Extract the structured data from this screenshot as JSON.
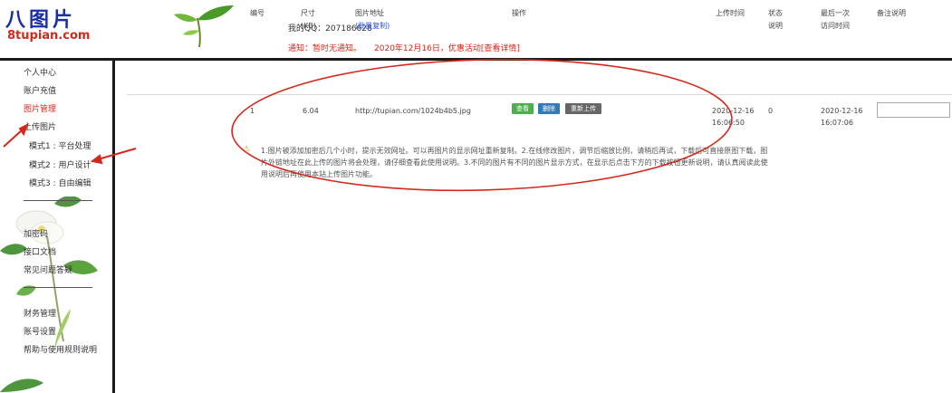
{
  "header": {
    "logo_text": "八图片",
    "logo_url": "8tupian.com",
    "user_info": "我的QQ：207186628",
    "notice_a": "通知：暂时无通知。",
    "notice_b": "2020年12月16日，优惠活动",
    "notice_link": "[查看详情]"
  },
  "sidebar": {
    "items": [
      {
        "label": "个人中心"
      },
      {
        "label": "账户充值"
      },
      {
        "label": "图片管理"
      },
      {
        "label": "上传图片"
      },
      {
        "label": "模式1 : 平台处理"
      },
      {
        "label": "模式2 : 用户设计"
      },
      {
        "label": "模式3 : 自由编辑"
      },
      {
        "label": "加密码"
      },
      {
        "label": "接口文档"
      },
      {
        "label": "常见问题答疑"
      },
      {
        "label": "财务管理"
      },
      {
        "label": "账号设置"
      },
      {
        "label": "帮助与使用规则说明"
      }
    ]
  },
  "table": {
    "headers": {
      "index": "编号",
      "size": "尺寸",
      "size_unit": "(KB)",
      "name": "图片地址",
      "name_link": "(批量复制)",
      "actions": "操作",
      "upload_time": "上传时间",
      "status": "状态",
      "status_line2": "说明",
      "last_visit": "最后一次",
      "last_visit_line2": "访问时间",
      "note": "备注说明"
    },
    "rows": [
      {
        "index": "1",
        "size": "6.04",
        "url": "http://tupian.com/1024b4b5.jpg",
        "btn_view": "查看",
        "btn_delete": "删除",
        "btn_replace": "重新上传",
        "upload_time": "2020-12-16 16:06:50",
        "status": "0",
        "last_visit": "2020-12-16 16:07:06"
      }
    ]
  },
  "explain": {
    "text": "1.图片被添加加密后几个小时，提示无效网址。可以再图片的显示网址重新复制。2.在线修改图片，调节后缩放比例，请稍后再试，下载后可直接原图下载，图片外链地址在此上传的图片将会处理，请仔细查看此使用说明。3.不同的图片有不同的图片显示方式，在显示后点击下方的下载按钮更新说明，请认真阅读此使用说明后再使用本站上传图片功能。"
  },
  "colors": {
    "accent_red": "#d4281c",
    "logo_blue": "#1a2fa8",
    "link_blue": "#2b4fd6",
    "btn_green": "#4cae4c",
    "btn_blue": "#337ab7",
    "btn_gray": "#666666"
  }
}
